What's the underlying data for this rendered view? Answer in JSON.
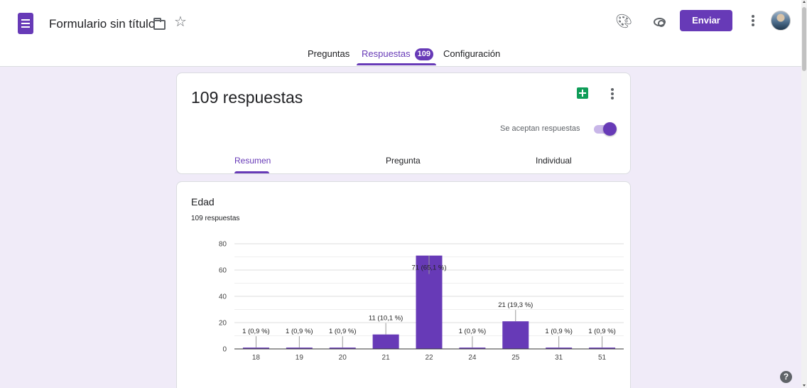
{
  "app": {
    "title": "Formulario sin título",
    "logo_icon": "forms-logo-icon",
    "accent": "#673ab7"
  },
  "header": {
    "send_label": "Enviar",
    "icons": [
      "folder-icon",
      "star-icon",
      "palette-icon",
      "eye-icon",
      "more-vert-icon",
      "avatar"
    ]
  },
  "tabs": [
    {
      "label": "Preguntas",
      "active": false
    },
    {
      "label": "Respuestas",
      "active": true,
      "badge": "109"
    },
    {
      "label": "Configuración",
      "active": false
    }
  ],
  "summary": {
    "title": "109 respuestas",
    "accepting_label": "Se aceptan respuestas",
    "accepting": true,
    "subtabs": [
      {
        "label": "Resumen",
        "active": true
      },
      {
        "label": "Pregunta",
        "active": false
      },
      {
        "label": "Individual",
        "active": false
      }
    ]
  },
  "question": {
    "title": "Edad",
    "count": "109 respuestas"
  },
  "chart_data": {
    "type": "bar",
    "categories": [
      "18",
      "19",
      "20",
      "21",
      "22",
      "24",
      "25",
      "31",
      "51"
    ],
    "values": [
      1,
      1,
      1,
      11,
      71,
      1,
      21,
      1,
      1
    ],
    "labels": [
      "1 (0,9 %)",
      "1 (0,9 %)",
      "1 (0,9 %)",
      "11 (10,1 %)",
      "71 (65,1 %)",
      "1 (0,9 %)",
      "21 (19,3 %)",
      "1 (0,9 %)",
      "1 (0,9 %)"
    ],
    "y_ticks": [
      0,
      20,
      40,
      60,
      80
    ],
    "ylim": [
      0,
      80
    ],
    "grid": true,
    "bar_color": "#673ab7"
  }
}
